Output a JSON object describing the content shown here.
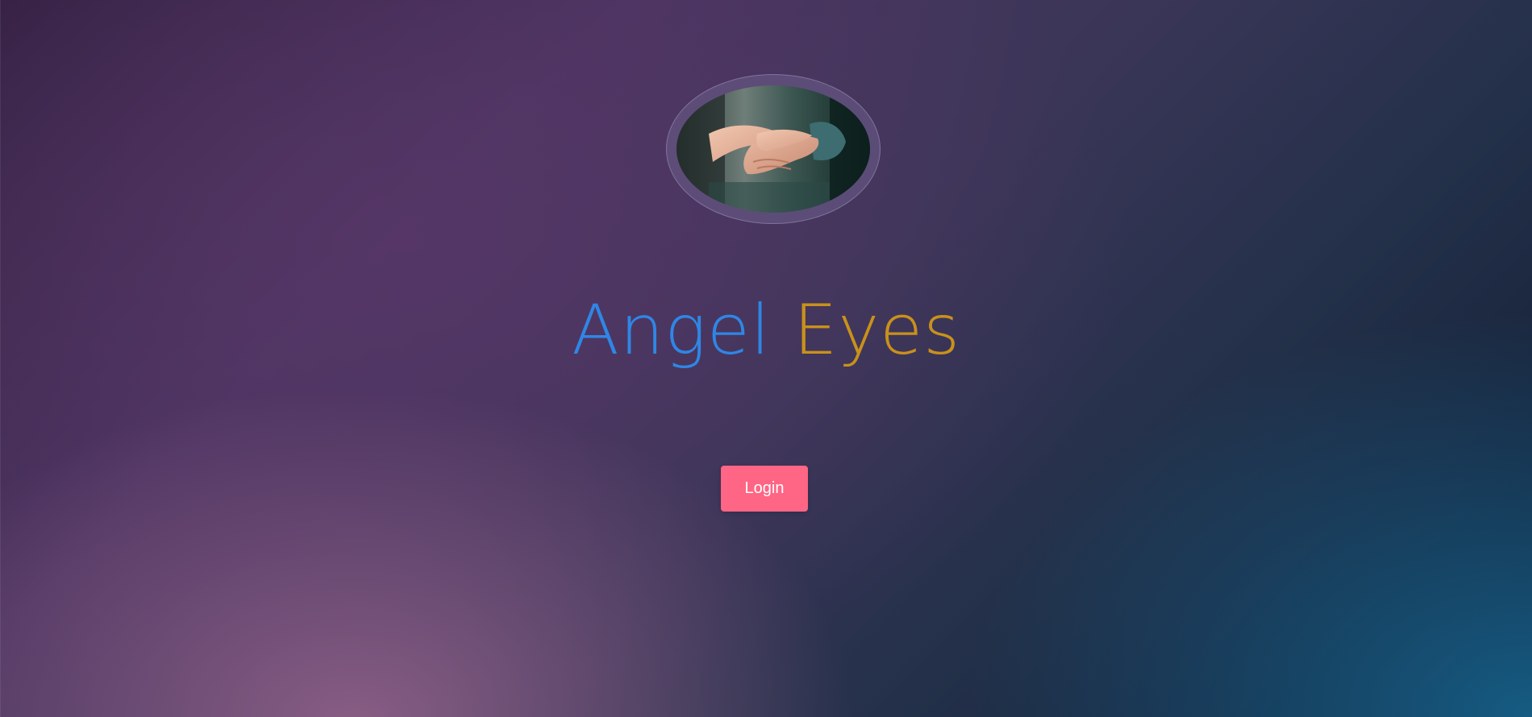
{
  "app": {
    "title_part1": "Angel",
    "title_part2": "Eyes",
    "title_colors": {
      "angel": "#2f86e6",
      "eyes": "#c9911b"
    }
  },
  "hero": {
    "image_icon": "holding-hands-photo"
  },
  "actions": {
    "login_label": "Login",
    "login_color": "#ff6584"
  }
}
